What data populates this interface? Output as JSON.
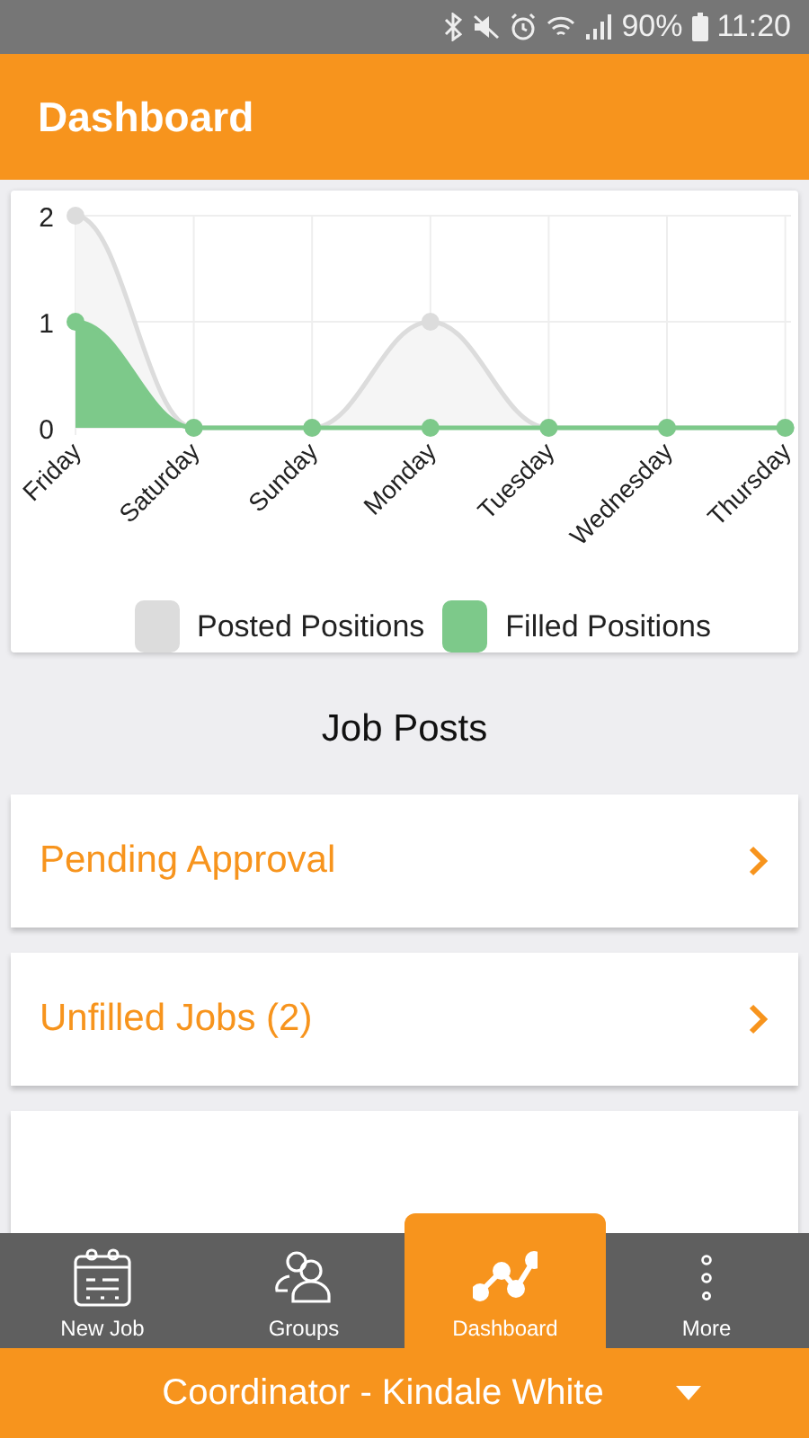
{
  "status_bar": {
    "battery": "90%",
    "time": "11:20"
  },
  "header": {
    "title": "Dashboard"
  },
  "chart_data": {
    "type": "area",
    "grid": true,
    "categories": [
      "Friday",
      "Saturday",
      "Sunday",
      "Monday",
      "Tuesday",
      "Wednesday",
      "Thursday"
    ],
    "yticks": [
      0,
      1,
      2
    ],
    "ylim": [
      0,
      2
    ],
    "series": [
      {
        "name": "Posted Positions",
        "color": "#dcdcdc",
        "values": [
          2,
          0,
          0,
          1,
          0,
          0,
          0
        ]
      },
      {
        "name": "Filled Positions",
        "color": "#7dc98a",
        "values": [
          1,
          0,
          0,
          0,
          0,
          0,
          0
        ]
      }
    ]
  },
  "section_title": "Job Posts",
  "job_links": [
    {
      "kind": "link",
      "label": "Pending Approval"
    },
    {
      "kind": "link",
      "label": "Unfilled Jobs (2)"
    },
    {
      "kind": "blank"
    }
  ],
  "nav": [
    {
      "label": "New Job",
      "selected": false
    },
    {
      "label": "Groups",
      "selected": false
    },
    {
      "label": "Dashboard",
      "selected": true
    },
    {
      "label": "More",
      "selected": false
    }
  ],
  "account": {
    "label": "Coordinator - Kindale White"
  }
}
